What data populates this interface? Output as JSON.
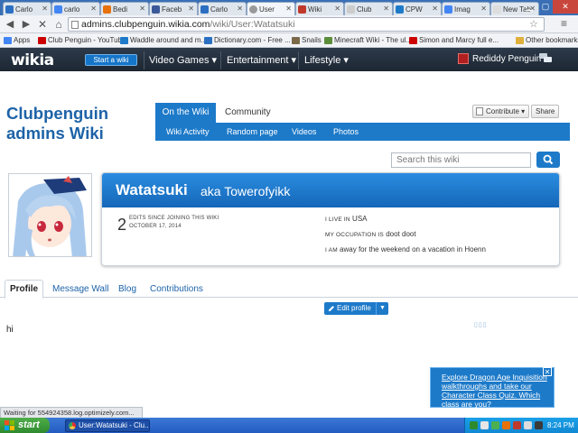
{
  "browser": {
    "tabs": [
      {
        "label": "Carlo",
        "color": "#2b6fc2",
        "active": false
      },
      {
        "label": "carlo",
        "color": "#4285f4",
        "active": false
      },
      {
        "label": "Bedi",
        "color": "#e8710a",
        "active": false
      },
      {
        "label": "Faceb",
        "color": "#3b5998",
        "active": false
      },
      {
        "label": "Carlo",
        "color": "#2b6fc2",
        "active": false
      },
      {
        "label": "User",
        "color": "#999999",
        "active": true
      },
      {
        "label": "Wiki",
        "color": "#c0392b",
        "active": false
      },
      {
        "label": "Club",
        "color": "#cccccc",
        "active": false
      },
      {
        "label": "CPW",
        "color": "#1d7ac9",
        "active": false
      },
      {
        "label": "Imag",
        "color": "#4285f4",
        "active": false
      },
      {
        "label": "New Tab",
        "color": "#dddddd",
        "active": false
      }
    ],
    "url_host": "admins.clubpenguin.wikia.com",
    "url_path": "/wiki/User:Watatsuki",
    "bookmarks": [
      {
        "label": "Apps",
        "color": "#4285f4"
      },
      {
        "label": "Club Penguin - YouTube",
        "color": "#cc0000"
      },
      {
        "label": "Waddle around and m...",
        "color": "#1d7ac9"
      },
      {
        "label": "Dictionary.com - Free ...",
        "color": "#2b6fc2"
      },
      {
        "label": "Snails",
        "color": "#7a6a4a"
      },
      {
        "label": "Minecraft Wiki - The ul...",
        "color": "#5b8d3a"
      },
      {
        "label": "Simon and Marcy full e...",
        "color": "#cc0000"
      },
      {
        "label": "Other bookmarks",
        "color": "#e0b03c"
      }
    ]
  },
  "wikia": {
    "logo": "wikia",
    "start_wiki": "Start a wiki",
    "nav": [
      "Video Games ▾",
      "Entertainment ▾",
      "Lifestyle ▾"
    ],
    "username": "Rediddy Penguin ▾"
  },
  "wiki": {
    "title_line1": "Clubpenguin",
    "title_line2": "admins Wiki",
    "tab_on_wiki": "On the Wiki",
    "tab_community": "Community",
    "subnav": [
      "Wiki Activity",
      "Random page",
      "Videos",
      "Photos"
    ],
    "contribute": "Contribute ▾",
    "share": "Share",
    "search_placeholder": "Search this wiki"
  },
  "profile": {
    "username": "Watatsuki",
    "aka_label": "aka",
    "aka_name": "Towerofyikk",
    "edits_count": "2",
    "edits_label": "EDITS SINCE JOINING THIS WIKI",
    "join_date": "OCTOBER 17, 2014",
    "live_label": "I LIVE IN",
    "live_value": "USA",
    "occupation_label": "MY OCCUPATION IS",
    "occupation_value": "doot doot",
    "iam_label": "I AM",
    "iam_value": "away for the weekend on a vacation in Hoenn"
  },
  "profile_tabs": [
    "Profile",
    "Message Wall",
    "Blog",
    "Contributions"
  ],
  "edit_profile": "Edit profile",
  "body_text": "hi",
  "dots": "▯▯▯",
  "promo": "Explore Dragon Age Inquisition walkthroughs and take our Character Class Quiz. Which class are you?",
  "status": "Waiting for 554924358.log.optimizely.com...",
  "taskbar": {
    "start": "start",
    "item": "User:Watatsuki - Clu...",
    "clock": "8:24 PM"
  }
}
